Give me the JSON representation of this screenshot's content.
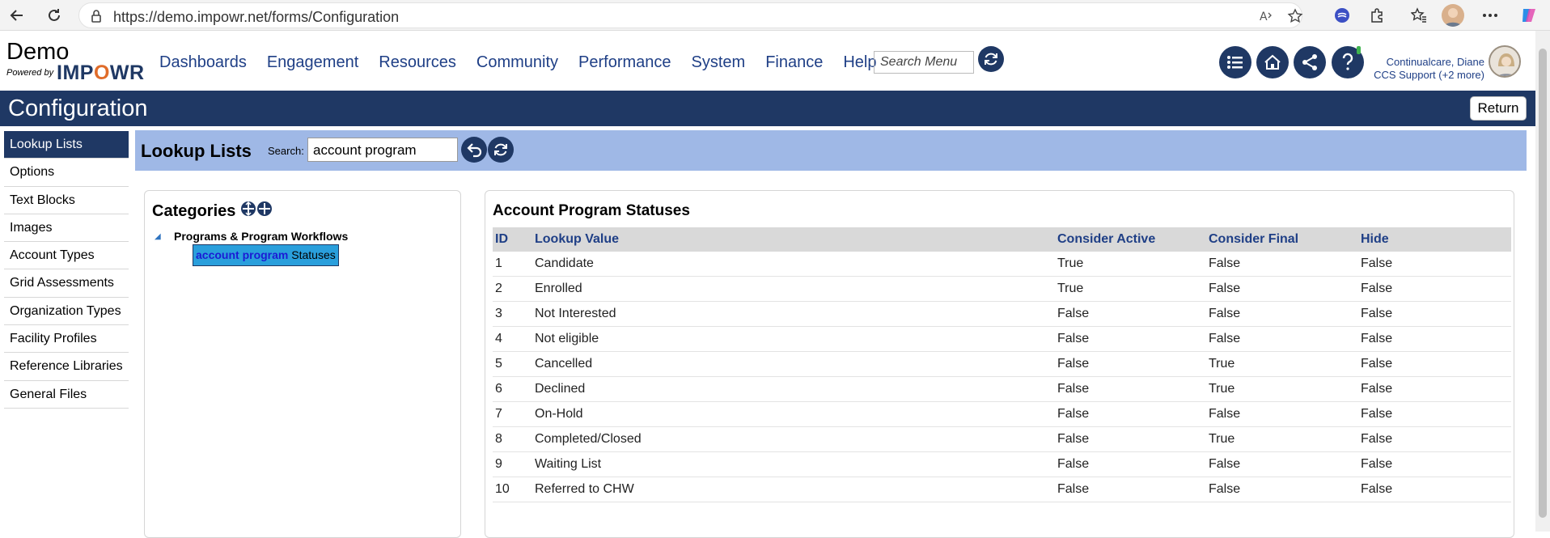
{
  "browser": {
    "url": "https://demo.impowr.net/forms/Configuration"
  },
  "brand": {
    "name": "Demo",
    "powered_by": "Powered by",
    "logo_text_1": "IMP",
    "logo_text_o": "O",
    "logo_text_2": "WR"
  },
  "menu": [
    "Dashboards",
    "Engagement",
    "Resources",
    "Community",
    "Performance",
    "System",
    "Finance",
    "Help"
  ],
  "search_menu": {
    "placeholder": "Search Menu"
  },
  "user": {
    "name": "Continualcare, Diane",
    "role": "CCS Support (+2 more)"
  },
  "page": {
    "title": "Configuration",
    "return_label": "Return"
  },
  "left_nav": [
    "Lookup Lists",
    "Options",
    "Text Blocks",
    "Images",
    "Account Types",
    "Grid Assessments",
    "Organization Types",
    "Facility Profiles",
    "Reference Libraries",
    "General Files"
  ],
  "lookup": {
    "title": "Lookup Lists",
    "search_label": "Search:",
    "search_value": "account program"
  },
  "categories": {
    "title": "Categories",
    "group": "Programs & Program Workflows",
    "leaf_highlight": "account program",
    "leaf_rest": " Statuses"
  },
  "statuses": {
    "title": "Account Program Statuses",
    "columns": [
      "ID",
      "Lookup Value",
      "Consider Active",
      "Consider Final",
      "Hide"
    ],
    "rows": [
      [
        "1",
        "Candidate",
        "True",
        "False",
        "False"
      ],
      [
        "2",
        "Enrolled",
        "True",
        "False",
        "False"
      ],
      [
        "3",
        "Not Interested",
        "False",
        "False",
        "False"
      ],
      [
        "4",
        "Not eligible",
        "False",
        "False",
        "False"
      ],
      [
        "5",
        "Cancelled",
        "False",
        "True",
        "False"
      ],
      [
        "6",
        "Declined",
        "False",
        "True",
        "False"
      ],
      [
        "7",
        "On-Hold",
        "False",
        "False",
        "False"
      ],
      [
        "8",
        "Completed/Closed",
        "False",
        "True",
        "False"
      ],
      [
        "9",
        "Waiting List",
        "False",
        "False",
        "False"
      ],
      [
        "10",
        "Referred to CHW",
        "False",
        "False",
        "False"
      ]
    ]
  }
}
